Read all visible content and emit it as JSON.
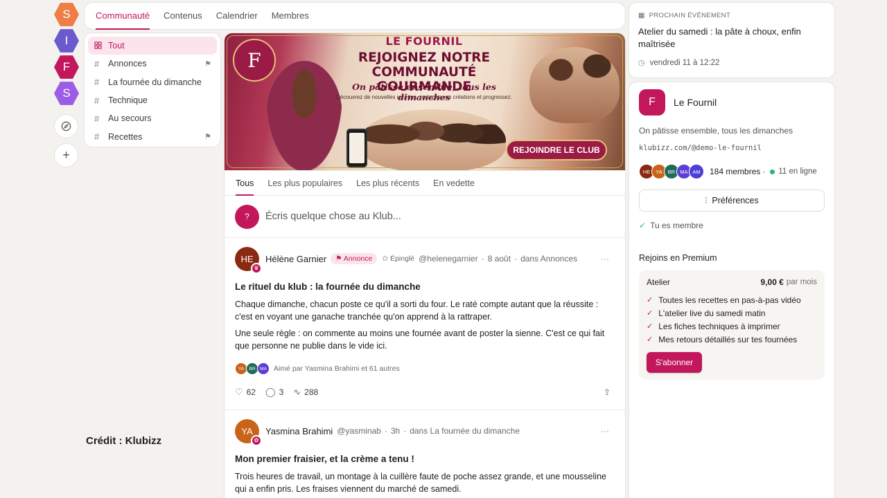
{
  "rail": {
    "items": [
      {
        "letter": "S",
        "color": "#ef7d45"
      },
      {
        "letter": "I",
        "color": "#6a5acd"
      },
      {
        "letter": "F",
        "color": "#c2185b"
      },
      {
        "letter": "S",
        "color": "#9b5de5"
      }
    ],
    "explore_glyph": "⊘",
    "add_glyph": "+"
  },
  "topnav": {
    "tabs": [
      "Communauté",
      "Contenus",
      "Calendrier",
      "Membres"
    ]
  },
  "channels": {
    "items": [
      {
        "label": "Tout",
        "icon": "grid-icon"
      },
      {
        "label": "Annonces",
        "icon": "hash-icon",
        "flag": true
      },
      {
        "label": "La fournée du dimanche",
        "icon": "hash-icon"
      },
      {
        "label": "Technique",
        "icon": "hash-icon"
      },
      {
        "label": "Au secours",
        "icon": "hash-icon"
      },
      {
        "label": "Recettes",
        "icon": "hash-icon",
        "flag": true
      }
    ]
  },
  "credit": "Crédit : Klubizz",
  "banner": {
    "logo_letter": "F",
    "brand": "LE FOURNIL",
    "headline": "REJOIGNEZ NOTRE COMMUNAUTÉ GOURMANDE",
    "tagline": "On pâtisse ensemble, tous les dimanches",
    "sub": "Découvrez de nouvelles recettes, partagez vos créations et progressez.",
    "cta": "REJOINDRE LE CLUB"
  },
  "feed_tabs": [
    "Tous",
    "Les plus populaires",
    "Les plus récents",
    "En vedette"
  ],
  "composer": {
    "avatar": "?",
    "placeholder": "Écris quelque chose au Klub..."
  },
  "posts": [
    {
      "initials": "HE",
      "color": "#8b2a12",
      "author": "Hélène Garnier",
      "tag": "Annonce",
      "pinned": "Épinglé",
      "handle": "@helenegarnier",
      "date": "8 août",
      "channel": "dans Annonces",
      "title": "Le rituel du klub : la fournée du dimanche",
      "paragraphs": [
        "Chaque dimanche, chacun poste ce qu'il a sorti du four. Le raté compte autant que la réussite : c'est en voyant une ganache tranchée qu'on apprend à la rattraper.",
        "Une seule règle : on commente au moins une fournée avant de poster la sienne. C'est ce qui fait que personne ne publie dans le vide ici."
      ],
      "likers": [
        {
          "initials": "YA",
          "color": "#c8641a"
        },
        {
          "initials": "BR",
          "color": "#1f6b5a"
        },
        {
          "initials": "MA",
          "color": "#5b3fd6"
        }
      ],
      "liked_by": "Aimé par Yasmina Brahimi et 61 autres",
      "likes": "62",
      "comments": "3",
      "views": "288"
    },
    {
      "initials": "YA",
      "color": "#c8641a",
      "author": "Yasmina Brahimi",
      "handle": "@yasminab",
      "date": "3h",
      "channel": "dans La fournée du dimanche",
      "title": "Mon premier fraisier, et la crème a tenu !",
      "paragraphs": [
        "Trois heures de travail, un montage à la cuillère faute de poche assez grande, et une mousseline qui a enfin pris. Les fraises viennent du marché de samedi."
      ]
    }
  ],
  "event": {
    "kicker": "PROCHAIN ÉVÉNEMENT",
    "title": "Atelier du samedi : la pâte à choux, enfin maîtrisée",
    "when": "vendredi 11 à 12:22"
  },
  "club": {
    "letter": "F",
    "name": "Le Fournil",
    "tagline": "On pâtisse ensemble, tous les dimanches",
    "url": "klubizz.com/@demo-le-fournil",
    "member_avatars": [
      {
        "initials": "HE",
        "color": "#8b2a12"
      },
      {
        "initials": "YA",
        "color": "#c8641a"
      },
      {
        "initials": "BR",
        "color": "#1f6b5a"
      },
      {
        "initials": "MA",
        "color": "#5b3fd6"
      },
      {
        "initials": "AM",
        "color": "#4a3fd6"
      }
    ],
    "members": "184 membres",
    "online": "11 en ligne",
    "preferences": "Préférences",
    "member_status": "Tu es membre",
    "premium_heading": "Rejoins en Premium",
    "plan_name": "Atelier",
    "plan_price": "9,00 €",
    "plan_period": "par mois",
    "features": [
      "Toutes les recettes en pas-à-pas vidéo",
      "L'atelier live du samedi matin",
      "Les fiches techniques à imprimer",
      "Mes retours détaillés sur tes fournées"
    ],
    "subscribe": "S'abonner"
  },
  "colors": {
    "accent": "#c2185b",
    "accent_soft": "#fbe4ec",
    "online": "#2bb673"
  }
}
